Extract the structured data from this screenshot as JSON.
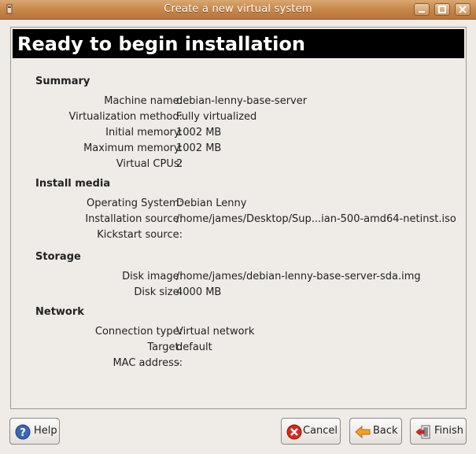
{
  "window": {
    "title": "Create a new virtual system"
  },
  "page": {
    "title": "Ready to begin installation"
  },
  "summary": {
    "heading": "Summary",
    "rows": [
      {
        "label": "Machine name:",
        "value": "debian-lenny-base-server"
      },
      {
        "label": "Virtualization method:",
        "value": "Fully virtualized"
      },
      {
        "label": "Initial memory:",
        "value": "1002 MB"
      },
      {
        "label": "Maximum memory:",
        "value": "1002 MB"
      },
      {
        "label": "Virtual CPUs:",
        "value": "2"
      }
    ]
  },
  "install_media": {
    "heading": "Install media",
    "rows": [
      {
        "label": "Operating System:",
        "value": "Debian Lenny"
      },
      {
        "label": "Installation source:",
        "value": "/home/james/Desktop/Sup...ian-500-amd64-netinst.iso"
      },
      {
        "label": "Kickstart source:",
        "value": ""
      }
    ]
  },
  "storage": {
    "heading": "Storage",
    "rows": [
      {
        "label": "Disk image:",
        "value": "/home/james/debian-lenny-base-server-sda.img"
      },
      {
        "label": "Disk size:",
        "value": "4000 MB"
      }
    ]
  },
  "network": {
    "heading": "Network",
    "rows": [
      {
        "label": "Connection type:",
        "value": "Virtual network"
      },
      {
        "label": "Target:",
        "value": "default"
      },
      {
        "label": "MAC address:",
        "value": "-"
      }
    ]
  },
  "buttons": {
    "help": "Help",
    "cancel": "Cancel",
    "back": "Back",
    "finish": "Finish"
  },
  "icons": {
    "help": "help-icon",
    "cancel": "cancel-icon",
    "back": "back-arrow-icon",
    "finish": "finish-icon"
  },
  "colors": {
    "titlebar": "#c98a4e",
    "header_bg": "#000000",
    "window_bg": "#efebe7"
  }
}
